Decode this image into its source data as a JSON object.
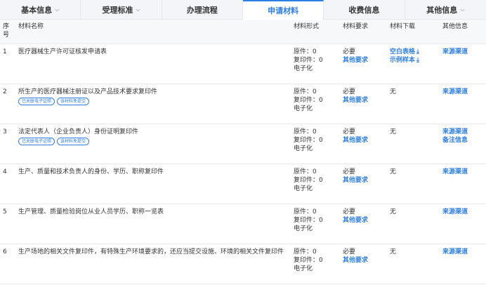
{
  "tabs": [
    {
      "label": "基本信息",
      "chevron": true,
      "active": false
    },
    {
      "label": "受理标准",
      "chevron": true,
      "active": false
    },
    {
      "label": "办理流程",
      "chevron": false,
      "active": false
    },
    {
      "label": "申请材料",
      "chevron": false,
      "active": true
    },
    {
      "label": "收费信息",
      "chevron": false,
      "active": false
    },
    {
      "label": "其他信息",
      "chevron": true,
      "active": false
    }
  ],
  "table": {
    "headers": {
      "no": "序号",
      "name": "材料名称",
      "form": "材料形式",
      "requirement": "材料要求",
      "download": "材料下载",
      "other": "其他信息"
    },
    "rows": [
      {
        "no": "1",
        "name": "医疗器械生产许可证核发申请表",
        "tags": [],
        "form": [
          "原件：0",
          "复印件：0",
          "电子化"
        ],
        "req": "必要",
        "req_link": "其他要求",
        "downloads": [
          "空白表格",
          "示例样本"
        ],
        "dl_text": "",
        "other": [
          "来源渠道"
        ]
      },
      {
        "no": "2",
        "name": "所生产的医疗器械注册证以及产品技术要求复印件",
        "tags": [
          "已关联电子证照",
          "该材料免提交"
        ],
        "form": [
          "原件：0",
          "复印件：0",
          "电子化"
        ],
        "req": "必要",
        "req_link": "其他要求",
        "downloads": [],
        "dl_text": "无",
        "other": [
          "来源渠道"
        ]
      },
      {
        "no": "3",
        "name": "法定代表人（企业负责人）身份证明复印件",
        "tags": [
          "已关联电子证照",
          "该材料免提交"
        ],
        "form": [
          "原件：0",
          "复印件：0",
          "电子化"
        ],
        "req": "必要",
        "req_link": "其他要求",
        "downloads": [],
        "dl_text": "无",
        "other": [
          "来源渠道",
          "备注信息"
        ]
      },
      {
        "no": "4",
        "name": "生产、质量和技术负责人的身份、学历、职称复印件",
        "tags": [],
        "form": [
          "原件：0",
          "复印件：0",
          "电子化"
        ],
        "req": "必要",
        "req_link": "其他要求",
        "downloads": [],
        "dl_text": "无",
        "other": [
          "来源渠道"
        ]
      },
      {
        "no": "5",
        "name": "生产管理、质量检验岗位从业人员学历、职称一览表",
        "tags": [],
        "form": [
          "原件：0",
          "复印件：0",
          "电子化"
        ],
        "req": "必要",
        "req_link": "其他要求",
        "downloads": [],
        "dl_text": "无",
        "other": [
          "来源渠道"
        ]
      },
      {
        "no": "6",
        "name": "生产场地的相关文件复印件，有特殊生产环境要求的，还应当提交设施、环境的相关文件复印件",
        "tags": [],
        "form": [
          "原件：0",
          "复印件：0",
          "电子化"
        ],
        "req": "必要",
        "req_link": "其他要求",
        "downloads": [],
        "dl_text": "无",
        "other": [
          "来源渠道"
        ]
      }
    ]
  },
  "icons": {
    "chevron": "chevron-down-icon",
    "download": "download-icon"
  },
  "colors": {
    "accent": "#2f7fe6",
    "header_bg": "#f7f8fa",
    "tab_bar_bg": "#f3f5f8"
  }
}
